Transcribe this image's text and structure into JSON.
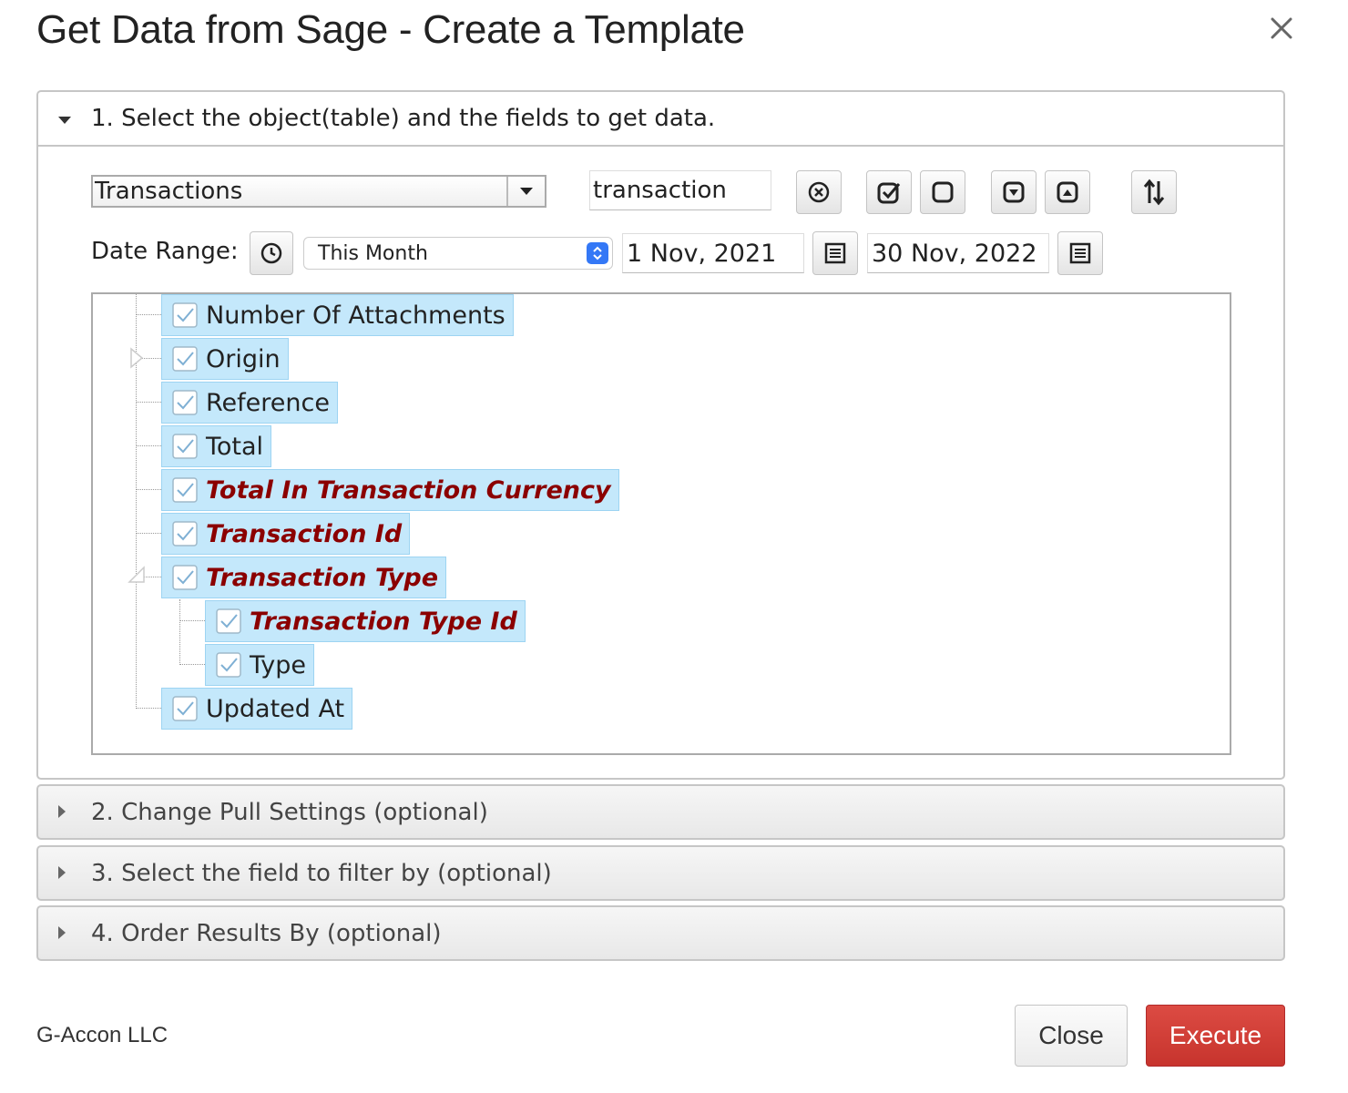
{
  "dialog": {
    "title": "Get Data from Sage - Create a Template",
    "close_icon": "close-x-icon"
  },
  "section1": {
    "header": "1. Select the object(table) and the fields to get data.",
    "object_select": {
      "value": "Transactions"
    },
    "search": {
      "value": "transaction"
    },
    "toolbar_icons": [
      "clear-search-icon",
      "check-all-icon",
      "uncheck-all-icon",
      "move-down-icon",
      "move-up-icon",
      "sort-icon"
    ],
    "date_range_label": "Date Range:",
    "date_range_select": {
      "value": "This Month"
    },
    "start_date": "1 Nov, 2021",
    "end_date": "30 Nov, 2022"
  },
  "tree": {
    "nodes": [
      {
        "label": "Number Of Attachments",
        "checked": true,
        "required": false,
        "level": 0
      },
      {
        "label": "Origin",
        "checked": true,
        "required": false,
        "level": 0,
        "expandable": true,
        "expanded": false
      },
      {
        "label": "Reference",
        "checked": true,
        "required": false,
        "level": 0
      },
      {
        "label": "Total",
        "checked": true,
        "required": false,
        "level": 0
      },
      {
        "label": "Total In Transaction Currency",
        "checked": true,
        "required": true,
        "level": 0
      },
      {
        "label": "Transaction Id",
        "checked": true,
        "required": true,
        "level": 0
      },
      {
        "label": "Transaction Type",
        "checked": true,
        "required": true,
        "level": 0,
        "expandable": true,
        "expanded": true
      },
      {
        "label": "Transaction Type Id",
        "checked": true,
        "required": true,
        "level": 1
      },
      {
        "label": "Type",
        "checked": true,
        "required": false,
        "level": 1
      },
      {
        "label": "Updated At",
        "checked": true,
        "required": false,
        "level": 0
      }
    ]
  },
  "section2": {
    "header": "2. Change Pull Settings (optional)"
  },
  "section3": {
    "header": "3. Select the field to filter by (optional)"
  },
  "section4": {
    "header": "4. Order Results By (optional)"
  },
  "footer": {
    "brand": "G-Accon LLC",
    "close_label": "Close",
    "execute_label": "Execute"
  },
  "colors": {
    "execute_button": "#d13b34",
    "tree_node_bg": "#c4e8fb",
    "required_field_text": "#8b0000"
  }
}
